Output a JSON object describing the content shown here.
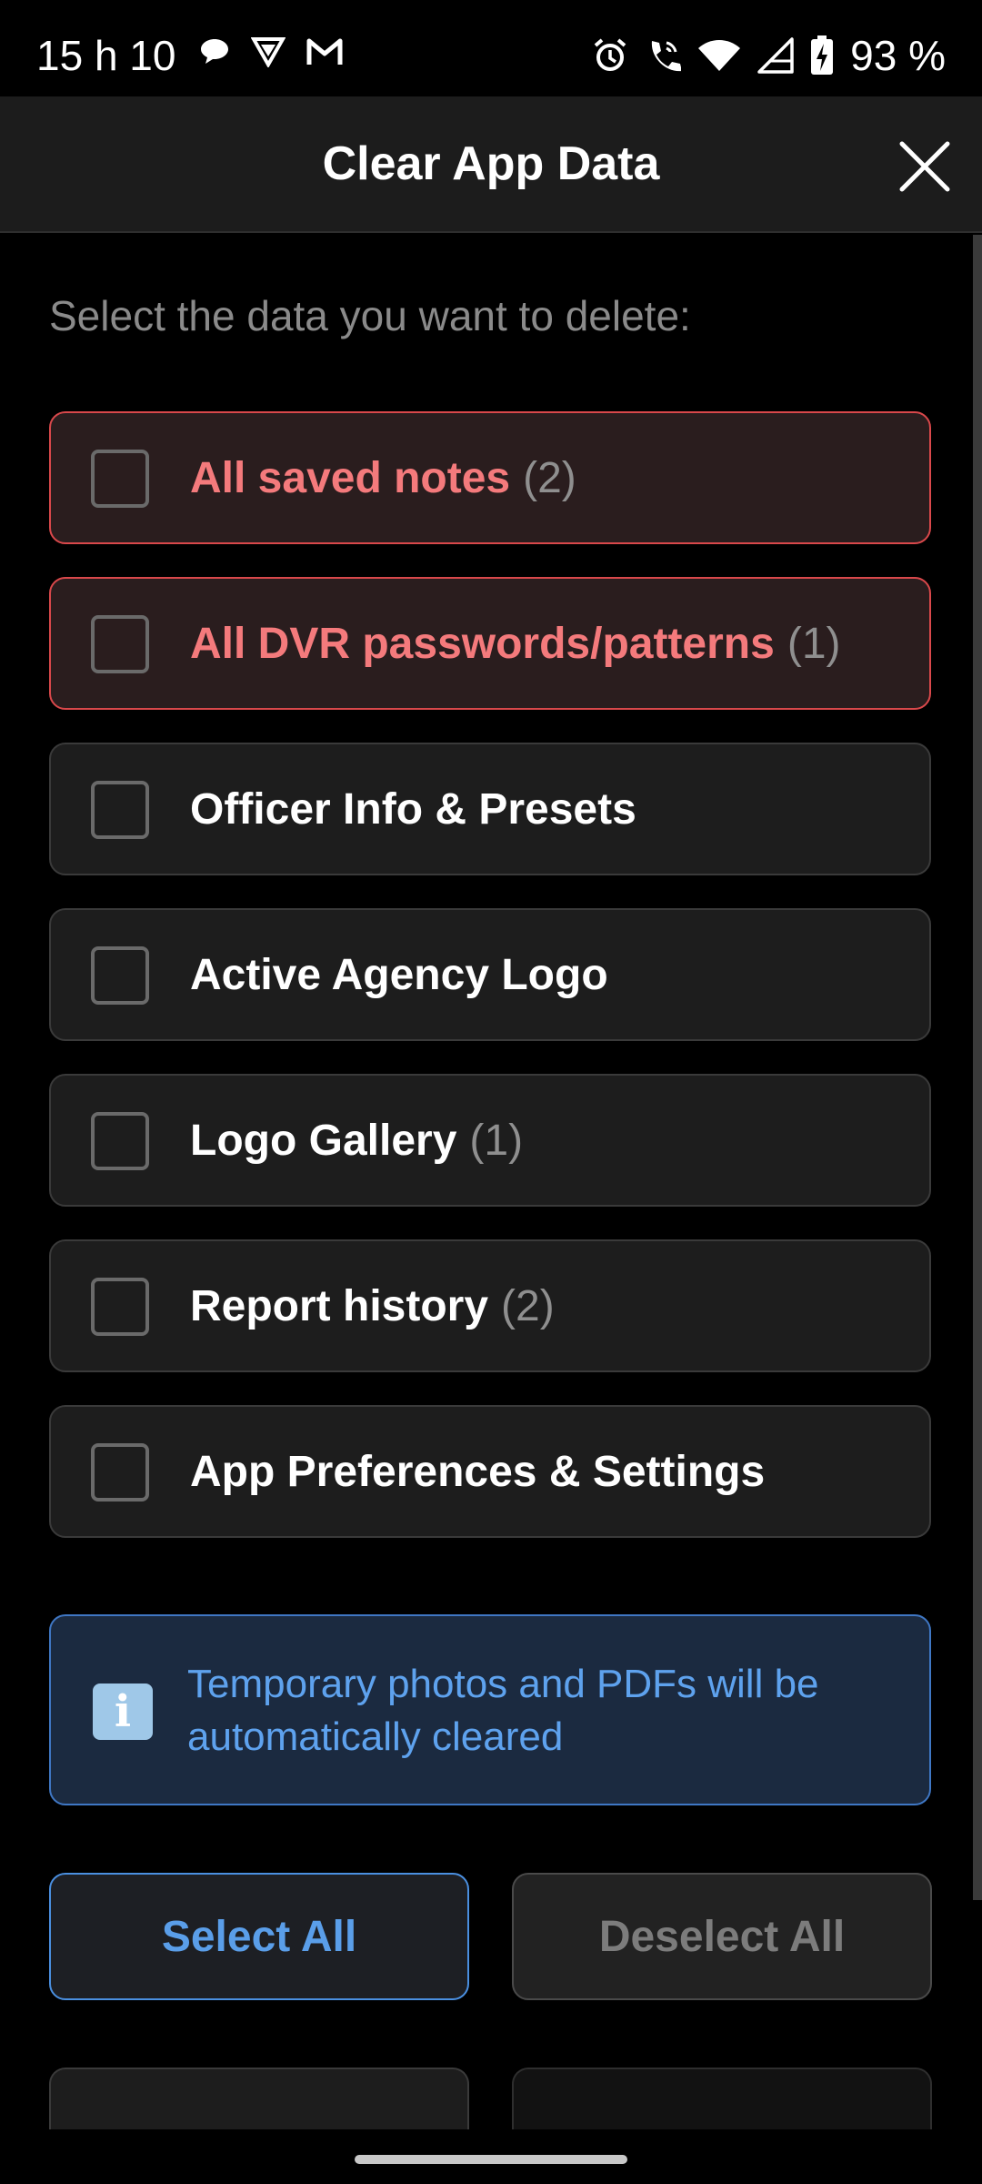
{
  "status_bar": {
    "time": "15 h 10",
    "left_icons": [
      "chat-bubble-icon",
      "vpn-shield-icon",
      "gmail-icon"
    ],
    "right_icons": [
      "alarm-icon",
      "wifi-call-icon",
      "wifi-icon",
      "signal-icon",
      "battery-charging-icon"
    ],
    "battery": "93 %"
  },
  "header": {
    "title": "Clear App Data",
    "close_icon": "close-icon"
  },
  "instruction": "Select the data you want to delete:",
  "options": [
    {
      "label": "All saved notes",
      "count": "(2)",
      "checked": false,
      "danger": true
    },
    {
      "label": "All DVR passwords/patterns",
      "count": "(1)",
      "checked": false,
      "danger": true
    },
    {
      "label": "Officer Info & Presets",
      "count": "",
      "checked": false,
      "danger": false
    },
    {
      "label": "Active Agency Logo",
      "count": "",
      "checked": false,
      "danger": false
    },
    {
      "label": "Logo Gallery",
      "count": "(1)",
      "checked": false,
      "danger": false
    },
    {
      "label": "Report history",
      "count": "(2)",
      "checked": false,
      "danger": false
    },
    {
      "label": "App Preferences & Settings",
      "count": "",
      "checked": false,
      "danger": false
    }
  ],
  "info": {
    "icon": "info-icon",
    "text": "Temporary photos and PDFs will be automatically cleared"
  },
  "buttons": {
    "select_all": "Select All",
    "deselect_all": "Deselect All"
  },
  "colors": {
    "danger": "#f47a7c",
    "accent": "#5a9ee9",
    "background": "#000000"
  }
}
